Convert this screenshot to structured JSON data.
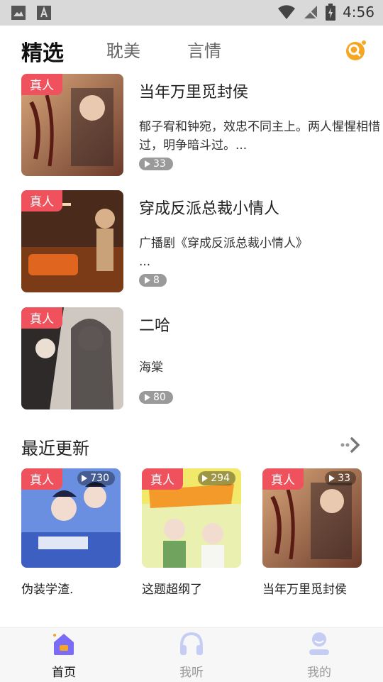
{
  "status_bar": {
    "time": "4:56"
  },
  "tabs": [
    {
      "label": "精选",
      "active": true
    },
    {
      "label": "耽美",
      "active": false
    },
    {
      "label": "言情",
      "active": false
    }
  ],
  "featured": [
    {
      "badge": "真人",
      "title": "当年万里觅封侯",
      "desc": "郁子宥和钟宛，效忠不同主上。两人惺惺相惜过，明争暗斗过。...",
      "count": "33"
    },
    {
      "badge": "真人",
      "title": "穿成反派总裁小情人",
      "desc": "广播剧《穿成反派总裁小情人》\n...",
      "count": "8"
    },
    {
      "badge": "真人",
      "title": "二哈",
      "desc": "海棠",
      "count": "80"
    }
  ],
  "recent": {
    "title": "最近更新",
    "items": [
      {
        "badge": "真人",
        "plays": "730",
        "label": "伪装学渣."
      },
      {
        "badge": "真人",
        "plays": "294",
        "label": "这题超纲了"
      },
      {
        "badge": "真人",
        "plays": "33",
        "label": "当年万里觅封侯"
      }
    ]
  },
  "bottom_nav": [
    {
      "label": "首页",
      "icon": "home-icon",
      "active": true
    },
    {
      "label": "我听",
      "icon": "headphones-icon",
      "active": false
    },
    {
      "label": "我的",
      "icon": "profile-icon",
      "active": false
    }
  ],
  "colors": {
    "accent": "#f5a623",
    "badge": "#f0525d",
    "nav_active": "#7b6cf6",
    "nav_inactive": "#c6cdf5"
  }
}
